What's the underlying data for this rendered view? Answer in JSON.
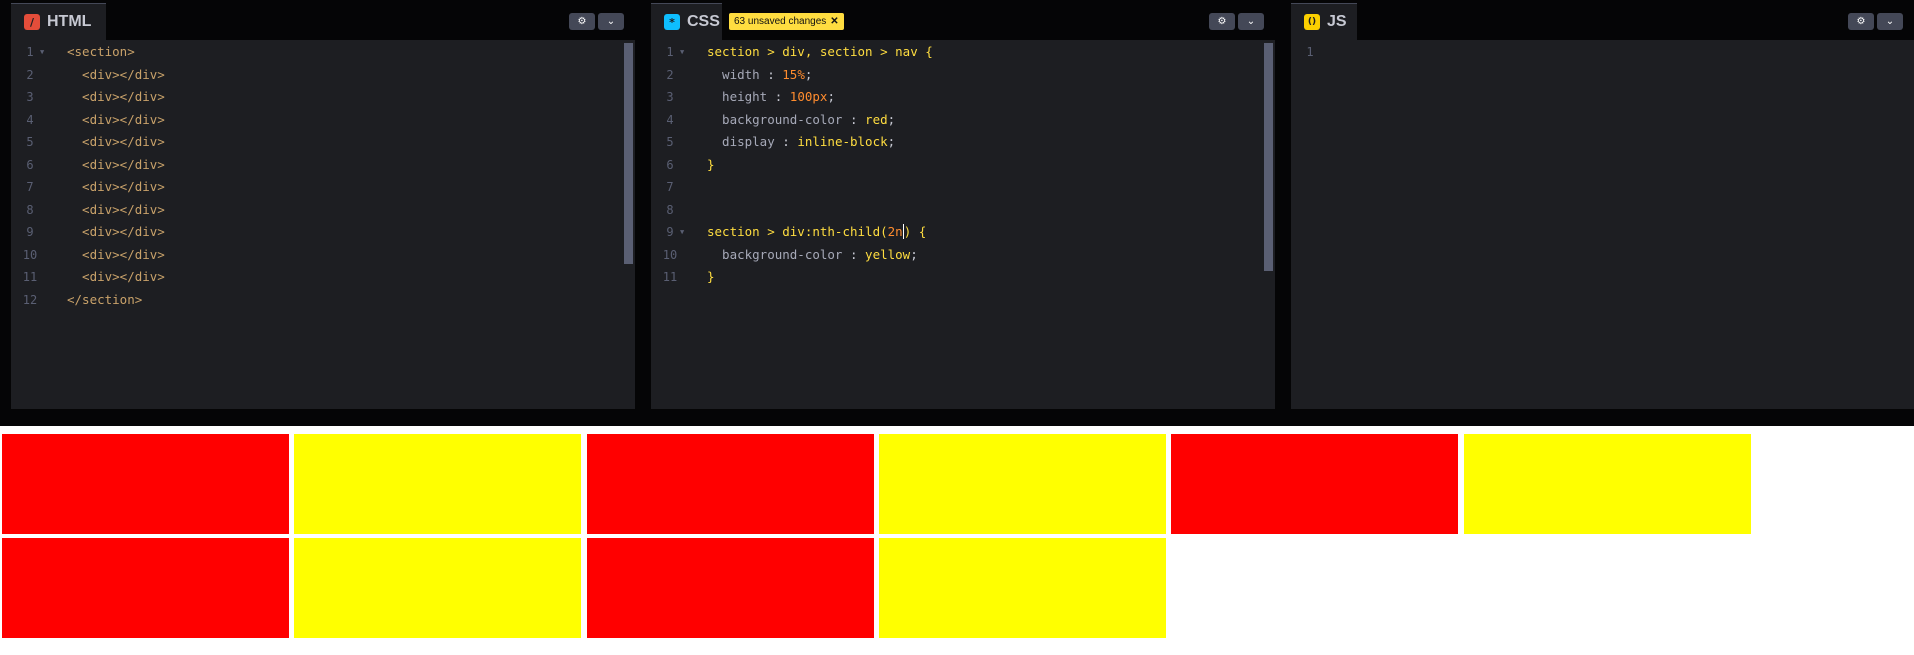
{
  "panes": {
    "html": {
      "label": "HTML",
      "icon": "html-slash-icon",
      "icon_glyph": "/",
      "icon_color": "#e44d3a",
      "lines": [
        [
          {
            "t": "<section>",
            "c": "t-tag"
          }
        ],
        [
          {
            "t": "  <div></div>",
            "c": "t-tag"
          }
        ],
        [
          {
            "t": "  <div></div>",
            "c": "t-tag"
          }
        ],
        [
          {
            "t": "  <div></div>",
            "c": "t-tag"
          }
        ],
        [
          {
            "t": "  <div></div>",
            "c": "t-tag"
          }
        ],
        [
          {
            "t": "  <div></div>",
            "c": "t-tag"
          }
        ],
        [
          {
            "t": "  <div></div>",
            "c": "t-tag"
          }
        ],
        [
          {
            "t": "  <div></div>",
            "c": "t-tag"
          }
        ],
        [
          {
            "t": "  <div></div>",
            "c": "t-tag"
          }
        ],
        [
          {
            "t": "  <div></div>",
            "c": "t-tag"
          }
        ],
        [
          {
            "t": "  <div></div>",
            "c": "t-tag"
          }
        ],
        [
          {
            "t": "</section>",
            "c": "t-tag"
          }
        ]
      ]
    },
    "css": {
      "label": "CSS",
      "icon": "css-asterisk-icon",
      "icon_glyph": "*",
      "icon_color": "#0ebeff",
      "unsaved_label": "63 unsaved changes",
      "unsaved_close_glyph": "✕",
      "lines": [
        [
          {
            "t": "section > div, section > nav {",
            "c": "t-sel"
          }
        ],
        [
          {
            "t": "  width",
            "c": "t-prop"
          },
          {
            "t": " : ",
            "c": "t-punc"
          },
          {
            "t": "15%",
            "c": "t-num"
          },
          {
            "t": ";",
            "c": "t-punc"
          }
        ],
        [
          {
            "t": "  height",
            "c": "t-prop"
          },
          {
            "t": " : ",
            "c": "t-punc"
          },
          {
            "t": "100px",
            "c": "t-num"
          },
          {
            "t": ";",
            "c": "t-punc"
          }
        ],
        [
          {
            "t": "  background-color",
            "c": "t-prop"
          },
          {
            "t": " : ",
            "c": "t-punc"
          },
          {
            "t": "red",
            "c": "t-val"
          },
          {
            "t": ";",
            "c": "t-punc"
          }
        ],
        [
          {
            "t": "  display",
            "c": "t-prop"
          },
          {
            "t": " : ",
            "c": "t-punc"
          },
          {
            "t": "inline-block",
            "c": "t-val"
          },
          {
            "t": ";",
            "c": "t-punc"
          }
        ],
        [
          {
            "t": "}",
            "c": "t-sel"
          }
        ],
        [],
        [],
        [
          {
            "t": "section > div:nth-child(",
            "c": "t-sel"
          },
          {
            "t": "2n",
            "c": "t-num"
          },
          {
            "cursor": true
          },
          {
            "t": ") {",
            "c": "t-sel"
          }
        ],
        [
          {
            "t": "  background-color",
            "c": "t-prop"
          },
          {
            "t": " : ",
            "c": "t-punc"
          },
          {
            "t": "yellow",
            "c": "t-val"
          },
          {
            "t": ";",
            "c": "t-punc"
          }
        ],
        [
          {
            "t": "}",
            "c": "t-sel"
          }
        ]
      ]
    },
    "js": {
      "label": "JS",
      "icon": "js-braces-icon",
      "icon_glyph": "()",
      "icon_color": "#fcd000",
      "lines": [
        []
      ]
    }
  },
  "buttons": {
    "settings_glyph": "⚙",
    "dropdown_glyph": "⌄"
  },
  "preview": {
    "boxes": [
      "#ff0000",
      "#ffff00",
      "#ff0000",
      "#ffff00",
      "#ff0000",
      "#ffff00",
      "#ff0000",
      "#ffff00",
      "#ff0000",
      "#ffff00"
    ]
  },
  "colors": {
    "editor_bg": "#1d1e22",
    "chrome_bg": "#050506",
    "accent_yellow": "#ffdd40"
  }
}
